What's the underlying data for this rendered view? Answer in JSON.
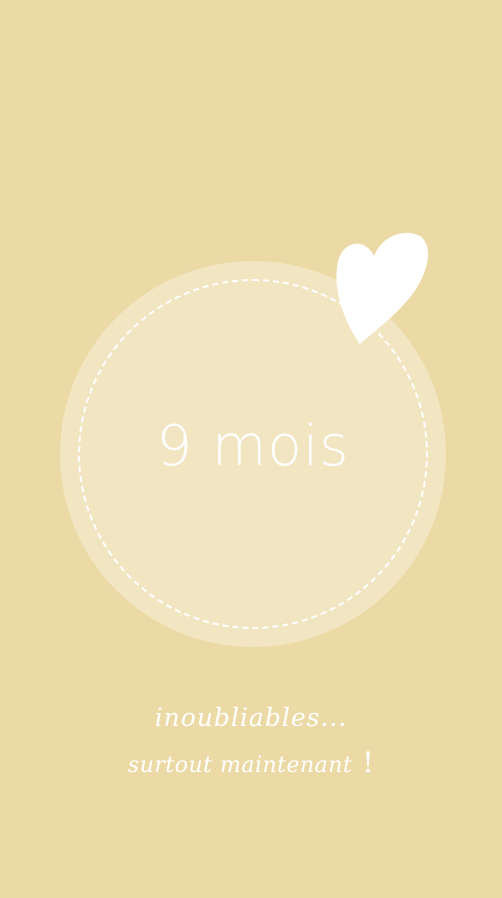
{
  "badge": {
    "text": "9 mois"
  },
  "icons": {
    "heart": "heart-icon"
  },
  "tagline": {
    "line1": "inoubliables...",
    "line2": "surtout maintenant",
    "line2_end": "!"
  },
  "colors": {
    "background": "#ecdaa6",
    "badge_fill": "#f2e5c1",
    "text": "#ffffff"
  }
}
